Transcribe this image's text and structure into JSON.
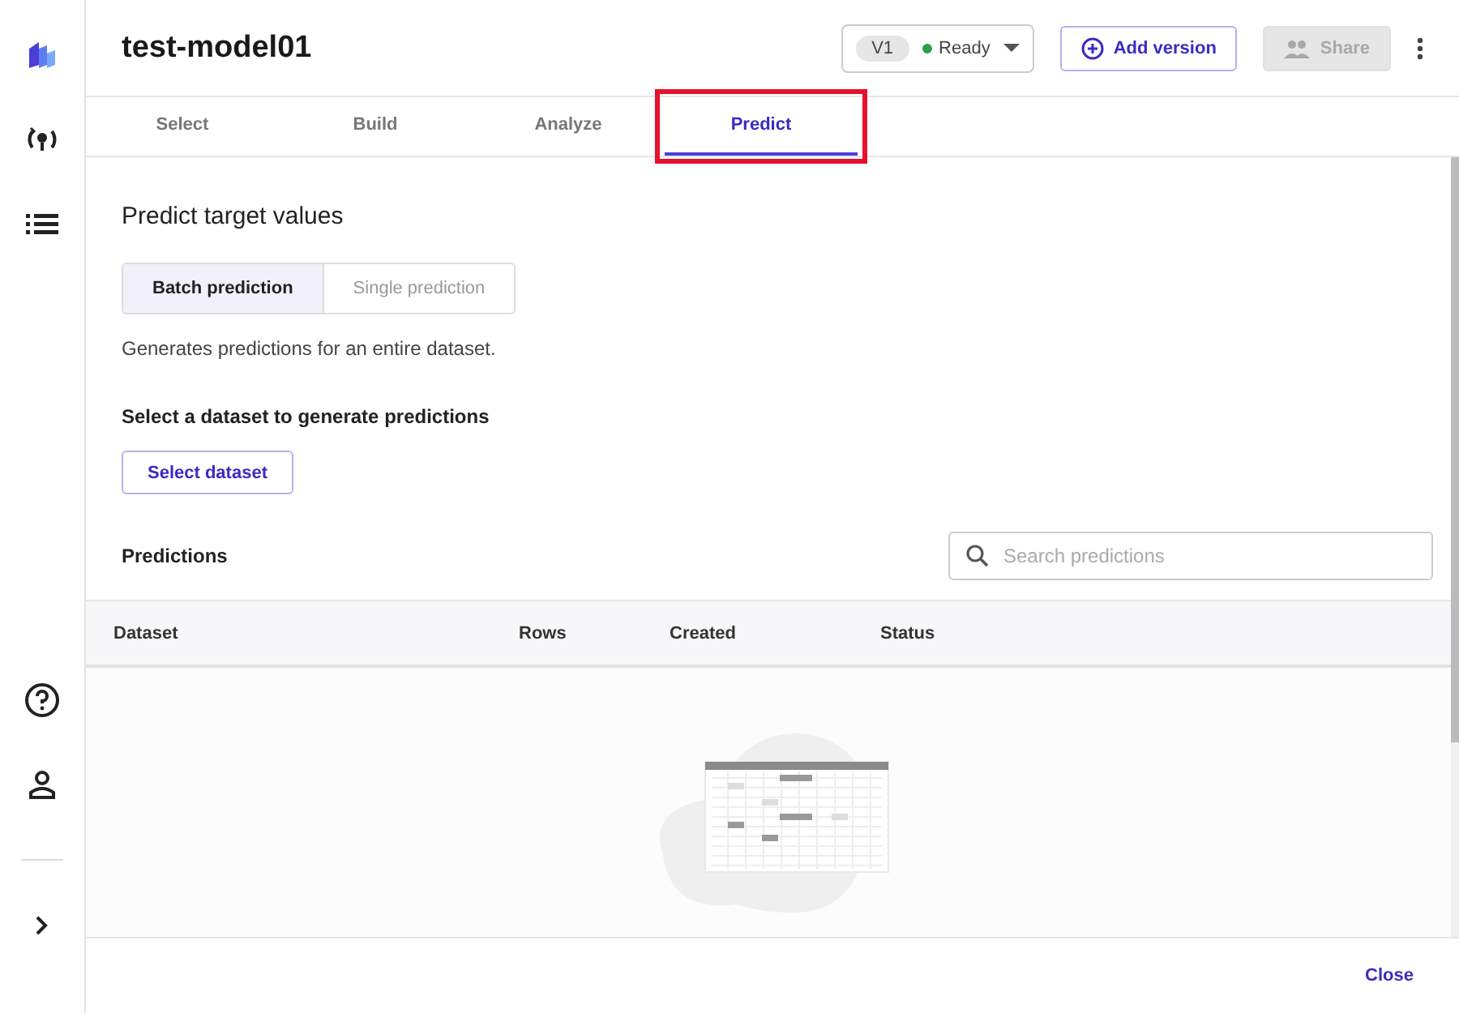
{
  "header": {
    "title": "test-model01",
    "version": {
      "label": "V1",
      "status": "Ready"
    },
    "buttons": [
      {
        "label": "Add version",
        "disabled": false
      },
      {
        "label": "Share",
        "disabled": true
      }
    ]
  },
  "tabs": [
    {
      "label": "Select",
      "selected": false,
      "highlighted": false
    },
    {
      "label": "Build",
      "selected": false,
      "highlighted": false
    },
    {
      "label": "Analyze",
      "selected": false,
      "highlighted": false
    },
    {
      "label": "Predict",
      "selected": true,
      "highlighted": true
    }
  ],
  "content": {
    "title": "Predict target values",
    "modes": [
      {
        "label": "Batch prediction",
        "selected": true
      },
      {
        "label": "Single prediction",
        "selected": false
      }
    ],
    "description": "Generates predictions for an entire dataset.",
    "dataset_heading": "Select a dataset to generate predictions",
    "select_button": "Select dataset",
    "predictions_heading": "Predictions",
    "search": {
      "placeholder": "Search predictions"
    },
    "table": {
      "columns": [
        "Dataset",
        "Rows",
        "Created",
        "Status"
      ]
    }
  },
  "footer": {
    "close": "Close"
  }
}
